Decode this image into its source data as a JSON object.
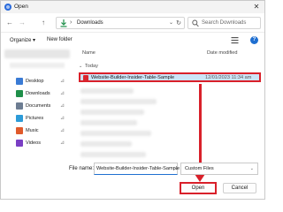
{
  "window": {
    "title": "Open",
    "close_glyph": "✕"
  },
  "nav": {
    "back_glyph": "←",
    "forward_glyph": "→",
    "up_glyph": "↑",
    "separator": "›",
    "path": "Downloads",
    "dropdown_glyph": "⌄",
    "refresh_glyph": "↻",
    "search_placeholder": "Search Downloads"
  },
  "commands": {
    "organize": "Organize ▾",
    "new_folder": "New folder"
  },
  "sidebar": {
    "items": [
      {
        "label": "Desktop",
        "icon": "desktop-icon",
        "color": "#3a7bd5"
      },
      {
        "label": "Downloads",
        "icon": "downloads-icon",
        "color": "#1f8f4a"
      },
      {
        "label": "Documents",
        "icon": "documents-icon",
        "color": "#6d7d92"
      },
      {
        "label": "Pictures",
        "icon": "pictures-icon",
        "color": "#2c9bd8"
      },
      {
        "label": "Music",
        "icon": "music-icon",
        "color": "#e05a2b"
      },
      {
        "label": "Videos",
        "icon": "videos-icon",
        "color": "#7a3fc4"
      }
    ],
    "pin_glyph": "📌"
  },
  "list": {
    "col_name": "Name",
    "col_date": "Date modified",
    "group_label": "Today",
    "group_chevron": "⌄",
    "selected_file": {
      "name": "Website-Builder-Insider-Table-Sample",
      "date": "12/01/2023 11:34 am"
    }
  },
  "footer": {
    "file_name_label": "File name:",
    "file_name_value": "Website-Builder-Insider-Table-Sample",
    "file_type": "Custom Files",
    "open_label": "Open",
    "cancel_label": "Cancel"
  },
  "colors": {
    "accent": "#1f6fd1",
    "annotation": "#d9202a",
    "selection": "#cce4f7"
  }
}
